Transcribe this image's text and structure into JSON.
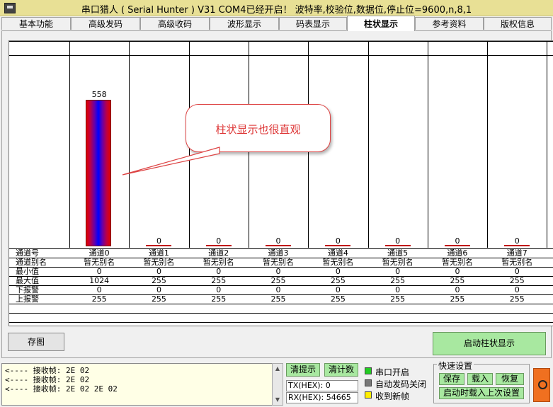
{
  "window": {
    "title": "串口猎人 ( Serial Hunter ) V31    COM4已经开启！ 波特率,校验位,数据位,停止位=9600,n,8,1"
  },
  "tabs": [
    "基本功能",
    "高级发码",
    "高级收码",
    "波形显示",
    "码表显示",
    "柱状显示",
    "参考资料",
    "版权信息"
  ],
  "active_tab": "柱状显示",
  "callout": {
    "text": "柱状显示也很直观"
  },
  "chart_data": {
    "type": "bar",
    "categories": [
      "通道0",
      "通道1",
      "通道2",
      "通道3",
      "通道4",
      "通道5",
      "通道6",
      "通道7"
    ],
    "values": [
      558,
      0,
      0,
      0,
      0,
      0,
      0,
      0
    ],
    "ylim": [
      0,
      1024
    ]
  },
  "table": {
    "row_labels": [
      "通道号",
      "通道别名",
      "最小值",
      "最大值",
      "下报警",
      "上报警"
    ],
    "channels": [
      "通道0",
      "通道1",
      "通道2",
      "通道3",
      "通道4",
      "通道5",
      "通道6",
      "通道7"
    ],
    "aliases": [
      "暂无别名",
      "暂无别名",
      "暂无别名",
      "暂无别名",
      "暂无别名",
      "暂无别名",
      "暂无别名",
      "暂无别名"
    ],
    "min": [
      "0",
      "0",
      "0",
      "0",
      "0",
      "0",
      "0",
      "0"
    ],
    "max": [
      "1024",
      "255",
      "255",
      "255",
      "255",
      "255",
      "255",
      "255"
    ],
    "low_alarm": [
      "0",
      "0",
      "0",
      "0",
      "0",
      "0",
      "0",
      "0"
    ],
    "high_alarm": [
      "255",
      "255",
      "255",
      "255",
      "255",
      "255",
      "255",
      "255"
    ]
  },
  "buttons": {
    "save_image": "存图",
    "start_bar": "启动柱状显示",
    "clear_tip": "清提示",
    "clear_count": "清计数"
  },
  "log": {
    "lines": [
      "<---- 接收帧: 2E 02",
      "<---- 接收帧: 2E 02",
      "<---- 接收帧: 2E 02 2E 02"
    ]
  },
  "counters": {
    "tx": "TX(HEX): 0",
    "rx": "RX(HEX): 54665"
  },
  "status": {
    "port_open": "串口开启",
    "auto_close": "自动发码关闭",
    "new_frame": "收到新帧",
    "colors": {
      "port_open": "#22cc22",
      "auto_close": "#777777",
      "new_frame": "#ffee00"
    }
  },
  "quick_settings": {
    "legend": "快速设置",
    "save": "保存",
    "load": "载入",
    "restore": "恢复",
    "load_on_start": "启动时载入上次设置"
  }
}
